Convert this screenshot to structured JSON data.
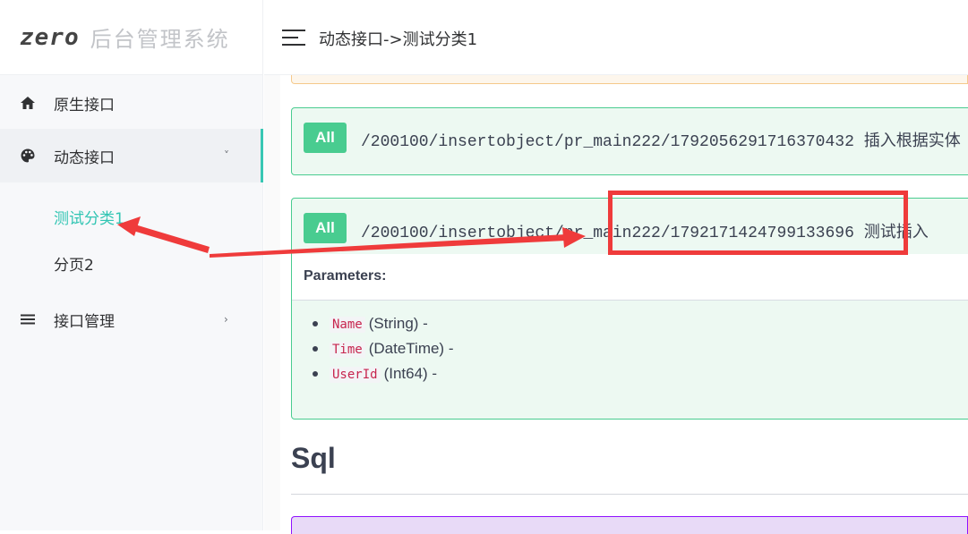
{
  "logo": {
    "mark": "zero",
    "title": "后台管理系统"
  },
  "sidebar": {
    "items": [
      {
        "label": "原生接口",
        "icon": "home-icon"
      },
      {
        "label": "动态接口",
        "icon": "palette-icon",
        "arrow": "˅",
        "expanded": true,
        "children": [
          {
            "label": "测试分类1",
            "active": true
          },
          {
            "label": "分页2"
          }
        ]
      },
      {
        "label": "接口管理",
        "icon": "menu-lines-icon",
        "arrow": "›"
      }
    ]
  },
  "header": {
    "breadcrumb": "动态接口->测试分类1"
  },
  "operations": [
    {
      "method": "All",
      "path": "/200100/insertobject/pr_main222/1792056291716370432 插入根据实体"
    },
    {
      "method": "All",
      "path": "/200100/insertobject/pr_main222/1792171424799133696 测试插入",
      "parameters_title": "Parameters:",
      "parameters": [
        {
          "name": "Name",
          "type": "(String) -"
        },
        {
          "name": "Time",
          "type": "(DateTime) -"
        },
        {
          "name": "UserId",
          "type": "(Int64) -"
        }
      ]
    }
  ],
  "section": {
    "title": "Sql"
  },
  "colors": {
    "accent": "#31c5b3",
    "method_all": "#49cc90",
    "annotation": "#ef3b3b"
  }
}
